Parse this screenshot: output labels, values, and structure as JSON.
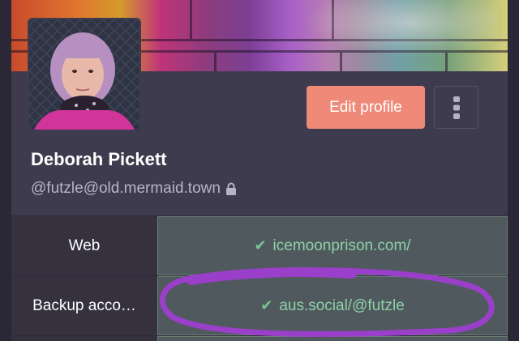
{
  "profile": {
    "display_name": "Deborah Pickett",
    "account": "@futzle@old.mermaid.town",
    "locked_icon": "lock-icon"
  },
  "actions": {
    "edit_label": "Edit profile",
    "more_icon": "vertical-ellipsis-icon"
  },
  "fields": [
    {
      "name": "Web",
      "value": "icemoonprison.com/",
      "verified": true
    },
    {
      "name": "Backup acco…",
      "value": "aus.social/@futzle",
      "verified": true
    }
  ],
  "colors": {
    "accent_button": "#f08a78",
    "verified_text": "#8fd0a8",
    "annotation_ink": "#9a3fc9"
  }
}
